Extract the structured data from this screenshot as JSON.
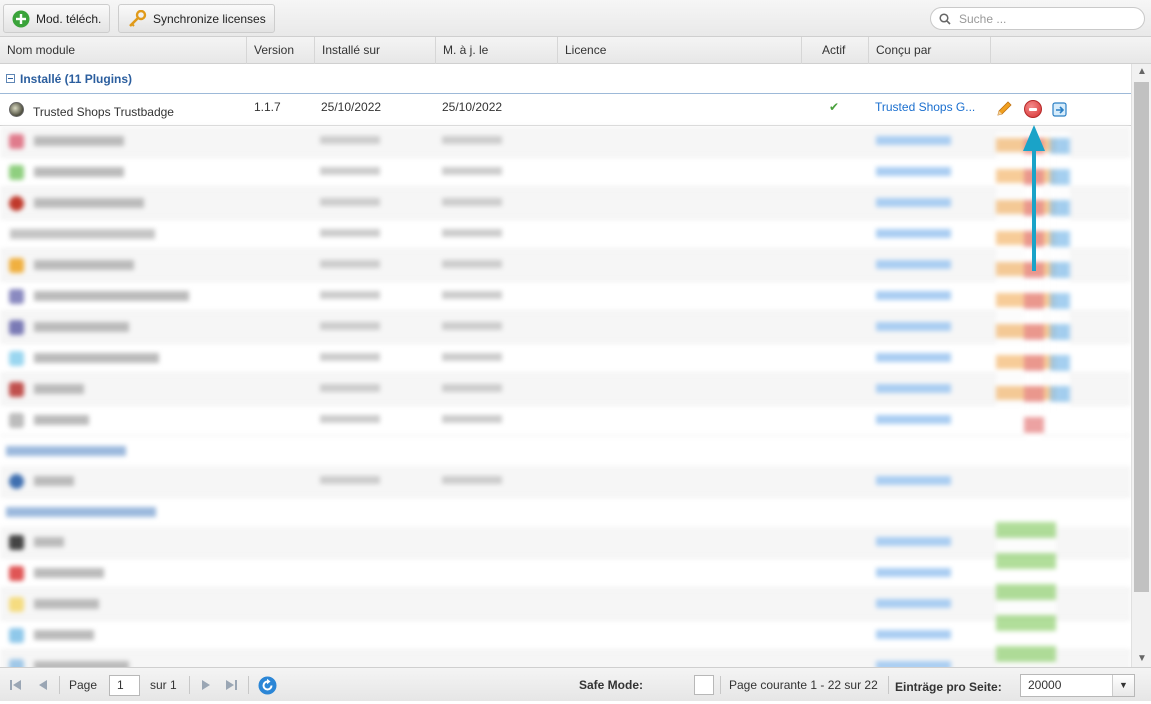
{
  "toolbar": {
    "upload_label": "Mod. téléch.",
    "sync_label": "Synchronize licenses",
    "search_placeholder": "Suche ..."
  },
  "columns": [
    "Nom module",
    "Version",
    "Installé sur",
    "M. à j. le",
    "Licence",
    "Actif",
    "Conçu par"
  ],
  "group_installed": "Installé (11 Plugins)",
  "first_row": {
    "name": "Trusted Shops Trustbadge",
    "version": "1.1.7",
    "installed": "25/10/2022",
    "updated": "25/10/2022",
    "licence": "",
    "active": "✔",
    "vendor": "Trusted Shops G..."
  },
  "footer": {
    "page_label": "Page",
    "page_value": "1",
    "of_label": "sur 1",
    "safe_mode_label": "Safe Mode:",
    "page_info": "Page courante 1 - 22 sur 22",
    "per_page_label": "Einträge pro Seite:",
    "per_page_value": "20000"
  },
  "colors": {
    "accent": "#2b5e9e",
    "link": "#1a6fcf",
    "active_check": "#4aa03c",
    "annotation_arrow": "#1aa3c8"
  }
}
